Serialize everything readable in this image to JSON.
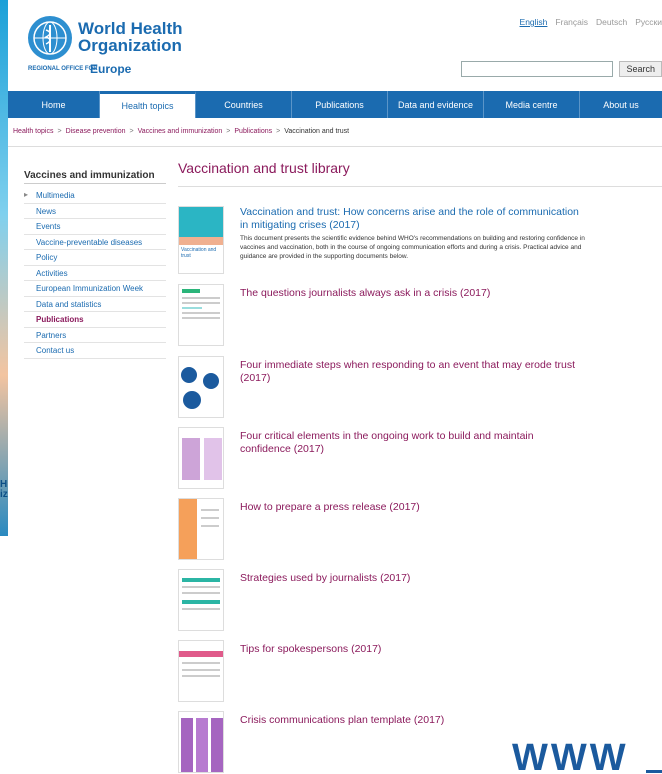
{
  "background": {
    "side_text": "H iz"
  },
  "header": {
    "logo_title": "World Health Organization",
    "logo_region": "REGIONAL OFFICE FOR",
    "logo_europe": "Europe",
    "languages": [
      "English",
      "Français",
      "Deutsch",
      "Русски"
    ],
    "search_placeholder": "",
    "search_button": "Search"
  },
  "nav": {
    "items": [
      "Home",
      "Health topics",
      "Countries",
      "Publications",
      "Data and evidence",
      "Media centre",
      "About us"
    ]
  },
  "breadcrumb": {
    "items": [
      "Health topics",
      "Disease prevention",
      "Vaccines and immunization",
      "Publications",
      "Vaccination and trust"
    ],
    "separator": ">"
  },
  "sidebar": {
    "title": "Vaccines and immunization",
    "items": [
      "Multimedia",
      "News",
      "Events",
      "Vaccine-preventable diseases",
      "Policy",
      "Activities",
      "European Immunization Week",
      "Data and statistics",
      "Publications",
      "Partners",
      "Contact us"
    ]
  },
  "main": {
    "title": "Vaccination and trust library",
    "items": [
      {
        "title": "Vaccination and trust: How concerns arise and the role of communication in mitigating crises (2017)",
        "desc": "This document presents the scientific evidence behind WHO's recommendations on building and restoring confidence in vaccines and vaccination, both in the course of ongoing communication efforts and during a crisis. Practical advice and guidance are provided in the supporting documents below.",
        "thumb_text": "Vaccination and trust"
      },
      {
        "title": "The questions journalists always ask in a crisis (2017)"
      },
      {
        "title": "Four immediate steps when responding to an event that may erode trust (2017)"
      },
      {
        "title": "Four critical elements in the ongoing work to build and maintain confidence (2017)"
      },
      {
        "title": "How to prepare a press release (2017)"
      },
      {
        "title": "Strategies used by journalists (2017)"
      },
      {
        "title": "Tips for spokespersons (2017)"
      },
      {
        "title": "Crisis communications plan template (2017)"
      }
    ]
  },
  "footer_overlay": {
    "text": "WWW"
  },
  "colors": {
    "brand_blue": "#1b6bb0",
    "link_purple": "#8b1a5c"
  }
}
